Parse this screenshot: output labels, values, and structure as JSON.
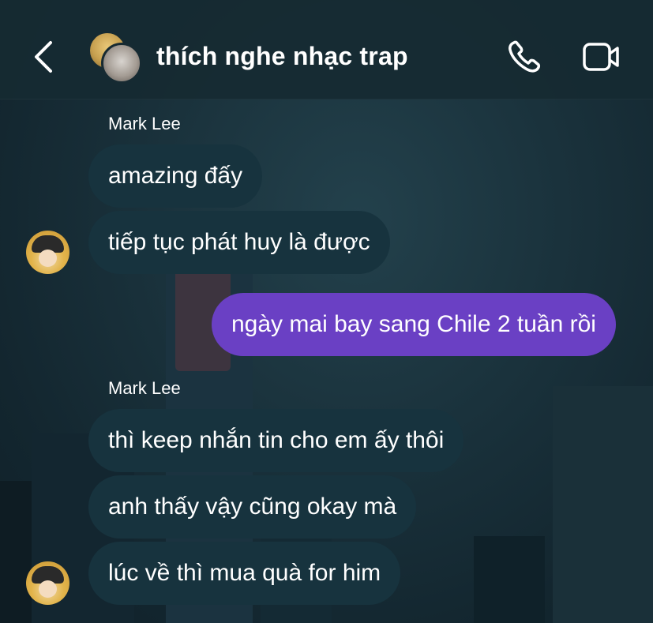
{
  "header": {
    "title": "thích nghe nhạc trap",
    "back_icon": "chevron-left-icon",
    "call_icon": "phone-icon",
    "video_icon": "video-camera-icon"
  },
  "messages": [
    {
      "sender": "Mark Lee"
    },
    {
      "text": "amazing đấy"
    },
    {
      "text": "tiếp tục phát huy là được"
    },
    {
      "text": "ngày mai bay sang Chile 2 tuần rồi"
    },
    {
      "sender": "Mark Lee"
    },
    {
      "text": "thì keep nhắn tin cho em ấy thôi"
    },
    {
      "text": "anh thấy vậy cũng okay mà"
    },
    {
      "text": "lúc về thì mua quà for him"
    }
  ],
  "colors": {
    "incoming_bubble": "#17333e",
    "outgoing_bubble": "#6a40c4",
    "background": "#162a33"
  }
}
